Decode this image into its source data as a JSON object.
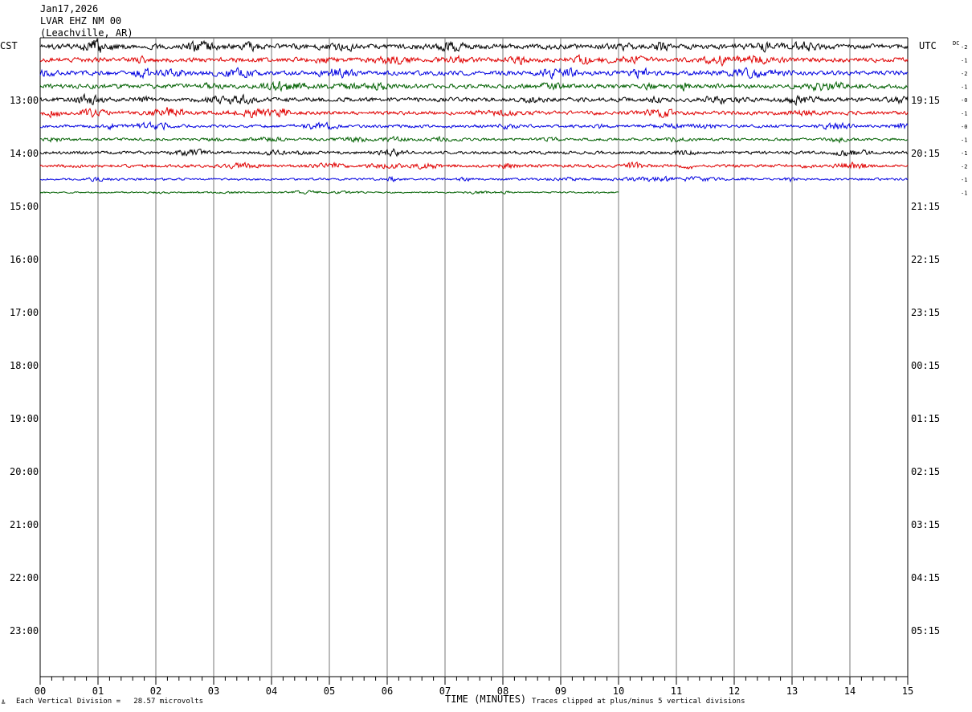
{
  "header": {
    "date": "Jan17,2026",
    "station": "LVAR EHZ NM 00",
    "location": "(Leachville, AR)"
  },
  "left_axis_label": "CST",
  "right_axis_label": "UTC",
  "dc_label": "DC",
  "footer": {
    "scale_text": "Each Vertical Division =   28.57 microvolts",
    "clip_text": "Traces clipped at plus/minus 5 vertical divisions",
    "corner_mark": "╩"
  },
  "chart_data": {
    "type": "line",
    "title": "",
    "xlabel": "TIME (MINUTES)",
    "ylabel": "",
    "xlim": [
      0,
      15
    ],
    "x_ticks": [
      "00",
      "01",
      "02",
      "03",
      "04",
      "05",
      "06",
      "07",
      "08",
      "09",
      "10",
      "11",
      "12",
      "13",
      "14",
      "15"
    ],
    "cst_labels": [
      "13:00",
      "14:00",
      "15:00",
      "16:00",
      "17:00",
      "18:00",
      "19:00",
      "20:00",
      "21:00",
      "22:00",
      "23:00"
    ],
    "utc_labels": [
      "19:15",
      "20:15",
      "21:15",
      "22:15",
      "23:15",
      "00:15",
      "01:15",
      "02:15",
      "03:15",
      "04:15",
      "05:15"
    ],
    "trace_colors": [
      "#000000",
      "#e00000",
      "#0000e0",
      "#006000"
    ],
    "traces": [
      {
        "index": 0,
        "color": "#000000",
        "end_minute": 15,
        "amplitude": 1.0,
        "dc": "-2"
      },
      {
        "index": 1,
        "color": "#e00000",
        "end_minute": 15,
        "amplitude": 0.9,
        "dc": "-1"
      },
      {
        "index": 2,
        "color": "#0000e0",
        "end_minute": 15,
        "amplitude": 0.9,
        "dc": "-2"
      },
      {
        "index": 3,
        "color": "#006000",
        "end_minute": 15,
        "amplitude": 0.9,
        "dc": "-1"
      },
      {
        "index": 4,
        "color": "#000000",
        "end_minute": 15,
        "amplitude": 0.85,
        "dc": "-0"
      },
      {
        "index": 5,
        "color": "#e00000",
        "end_minute": 15,
        "amplitude": 0.75,
        "dc": "-1"
      },
      {
        "index": 6,
        "color": "#0000e0",
        "end_minute": 15,
        "amplitude": 0.6,
        "dc": "-0"
      },
      {
        "index": 7,
        "color": "#006000",
        "end_minute": 15,
        "amplitude": 0.55,
        "dc": "-1"
      },
      {
        "index": 8,
        "color": "#000000",
        "end_minute": 15,
        "amplitude": 0.6,
        "dc": "-1"
      },
      {
        "index": 9,
        "color": "#e00000",
        "end_minute": 15,
        "amplitude": 0.6,
        "dc": "-2"
      },
      {
        "index": 10,
        "color": "#0000e0",
        "end_minute": 15,
        "amplitude": 0.45,
        "dc": "-1"
      },
      {
        "index": 11,
        "color": "#006000",
        "end_minute": 10,
        "amplitude": 0.3,
        "dc": "-1"
      }
    ],
    "grid": true
  }
}
